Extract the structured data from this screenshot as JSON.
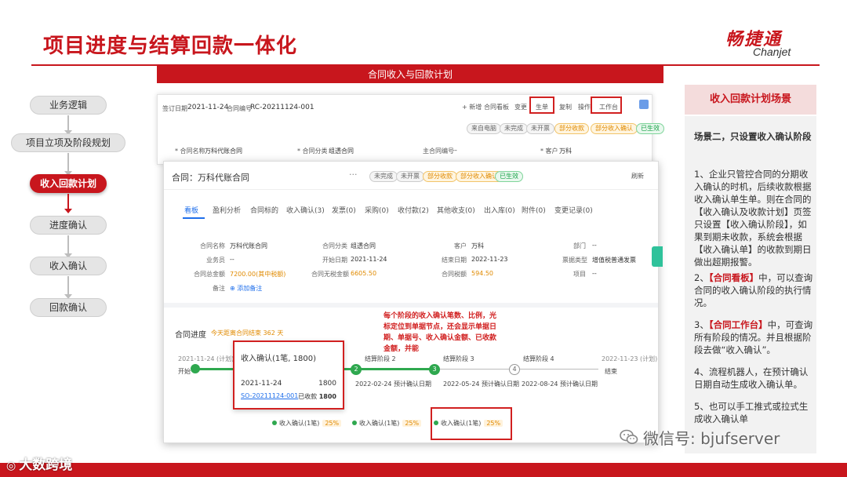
{
  "header": {
    "title": "项目进度与结算回款一体化",
    "logo_cn": "畅捷通",
    "logo_en": "Chanjet"
  },
  "flow": [
    "业务逻辑",
    "项目立项及阶段规划",
    "收入回款计划",
    "进度确认",
    "收入确认",
    "回款确认"
  ],
  "banner": "合同收入与回款计划",
  "back_window": {
    "sign_date_label": "签订日期",
    "sign_date": "2021-11-24",
    "contract_no_label": "合同编号",
    "contract_no": "RC-20211124-001",
    "toolbar": [
      "+ 新增",
      "合同看板",
      "变更",
      "生单",
      "复制",
      "操作",
      "工作台"
    ],
    "status_pills": [
      "来自电脑",
      "未完成",
      "未开票",
      "部分收款",
      "部分收入确认",
      "已生效"
    ],
    "fields": [
      {
        "label": "* 合同名称",
        "value": "万科代账合同"
      },
      {
        "label": "* 合同分类",
        "value": "组透合同"
      },
      {
        "label": "主合同编号",
        "value": "--"
      },
      {
        "label": "* 客户",
        "value": "万科"
      }
    ]
  },
  "front_window": {
    "title": "合同：万科代账合同",
    "dots": "···",
    "refresh": "刷新",
    "status_pills": [
      "未完成",
      "未开票",
      "部分收款",
      "部分收入确认",
      "已生效"
    ],
    "tabs": [
      "看板",
      "盈利分析",
      "合同标的",
      "收入确认(3)",
      "发票(0)",
      "采购(0)",
      "收付款(2)",
      "其他收支(0)",
      "出入库(0)",
      "附件(0)",
      "变更记录(0)"
    ],
    "fields": {
      "contract_name_label": "合同名称",
      "contract_name": "万科代账合同",
      "category_label": "合同分类",
      "category": "组透合同",
      "customer_label": "客户",
      "customer": "万科",
      "dept_label": "部门",
      "dept": "--",
      "salesman_label": "业务员",
      "salesman": "--",
      "start_label": "开始日期",
      "start": "2021-11-24",
      "end_label": "结束日期",
      "end": "2022-11-23",
      "invoice_type_label": "票据类型",
      "invoice_type": "增值税普通发票",
      "total_label": "合同总金额",
      "total": "7200.00(其中税额)",
      "untaxed_label": "合同无税金额",
      "untaxed": "6605.50",
      "tax_label": "合同税额",
      "tax": "594.50",
      "project_label": "项目",
      "project": "--",
      "note_label": "备注",
      "note": "添加备注"
    },
    "progress": {
      "label": "合同进度",
      "remaining": "今天距离合同结束 362 天",
      "start_date": "2021-11-24 (计划)",
      "start_text": "开始",
      "end_date": "2022-11-23 (计划)",
      "end_text": "结束",
      "stages": [
        {
          "num": "2",
          "name": "结算阶段 2",
          "date": "2022-02-24 预计确认日期"
        },
        {
          "num": "3",
          "name": "结算阶段 3",
          "date": "2022-05-24 预计确认日期"
        },
        {
          "num": "4",
          "name": "结算阶段 4",
          "date": "2022-08-24 预计确认日期"
        }
      ],
      "popup": {
        "title": "收入确认(1笔, 1800)",
        "date": "2021-11-24",
        "amount": "1800",
        "doc_no": "SO-20211124-001",
        "received_label": "已收款",
        "received": "1800"
      },
      "confirms": [
        {
          "label": "收入确认(1笔)",
          "pct": "25%"
        },
        {
          "label": "收入确认(1笔)",
          "pct": "25%"
        },
        {
          "label": "收入确认(1笔)",
          "pct": "25%"
        }
      ],
      "annotation": "每个阶段的收入确认笔数、比例，光标定位到单据节点，还会显示单据日期、单据号、收入确认金额、已收款金额，并能"
    }
  },
  "right_panel": {
    "header": "收入回款计划场景",
    "scene_title": "场景二，只设置收入确认阶段",
    "items": [
      "1、企业只管控合同的分期收入确认的时机，后续收款根据收入确认单生单。则在合同的【收入确认及收款计划】页签只设置【收入确认阶段】，如果到期未收款，系统会根据【收入确认单】的收款到期日做出超期报警。",
      "2、【合同看板】中，可以查询合同的收入确认阶段的执行情况。",
      "3、【合同工作台】中，可查询所有阶段的情况。并且根据阶段去做“收入确认”。",
      "4、流程机器人，在预计确认日期自动生成收入确认单。",
      "5、也可以手工推式或拉式生成收入确认单"
    ],
    "item2_prefix": "2、",
    "item2_hl": "【合同看板】",
    "item2_rest": "中，可以查询合同的收入确认阶段的执行情况。",
    "item3_prefix": "3、",
    "item3_hl": "【合同工作台】",
    "item3_rest": "中，可查询所有阶段的情况。并且根据阶段去做“收入确认”。"
  },
  "watermark": "微信号: bjufserver",
  "footer": "大数跨境",
  "colors": {
    "brand": "#c8161d",
    "green": "#2fa84f",
    "blue": "#1f6feb",
    "orange": "#e08a00"
  }
}
